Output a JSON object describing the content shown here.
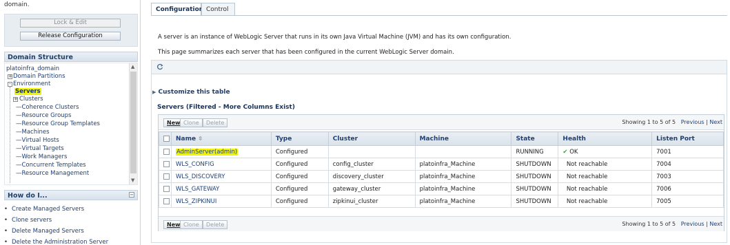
{
  "sidebar": {
    "domain_text": "domain.",
    "lock_edit": "Lock & Edit",
    "release_config": "Release Configuration",
    "domain_structure_title": "Domain Structure",
    "tree": {
      "root": "platoinfra_domain",
      "domain_partitions": "Domain Partitions",
      "environment": "Environment",
      "servers": "Servers",
      "clusters": "Clusters",
      "coherence_clusters": "Coherence Clusters",
      "resource_groups": "Resource Groups",
      "resource_group_templates": "Resource Group Templates",
      "machines": "Machines",
      "virtual_hosts": "Virtual Hosts",
      "virtual_targets": "Virtual Targets",
      "work_managers": "Work Managers",
      "concurrent_templates": "Concurrent Templates",
      "resource_management": "Resource Management"
    },
    "how_do_i_title": "How do I...",
    "how_items": [
      "Create Managed Servers",
      "Clone servers",
      "Delete Managed Servers",
      "Delete the Administration Server"
    ]
  },
  "tabs": {
    "configuration": "Configuration",
    "control": "Control"
  },
  "description": {
    "line1": "A server is an instance of WebLogic Server that runs in its own Java Virtual Machine (JVM) and has its own configuration.",
    "line2": "This page summarizes each server that has been configured in the current WebLogic Server domain."
  },
  "customize": "Customize this table",
  "table_title": "Servers (Filtered - More Columns Exist)",
  "buttons": {
    "new": "New",
    "clone": "Clone",
    "delete": "Delete"
  },
  "paging": {
    "showing": "Showing 1 to 5 of 5",
    "previous": "Previous",
    "separator": "|",
    "next": "Next"
  },
  "columns": [
    "Name",
    "Type",
    "Cluster",
    "Machine",
    "State",
    "Health",
    "Listen Port"
  ],
  "rows": [
    {
      "name": "AdminServer(admin)",
      "type": "Configured",
      "cluster": "",
      "machine": "",
      "state": "RUNNING",
      "health": "OK",
      "port": "7001"
    },
    {
      "name": "WLS_CONFIG",
      "type": "Configured",
      "cluster": "config_cluster",
      "machine": "platoinfra_Machine",
      "state": "SHUTDOWN",
      "health": "Not reachable",
      "port": "7004"
    },
    {
      "name": "WLS_DISCOVERY",
      "type": "Configured",
      "cluster": "discovery_cluster",
      "machine": "platoinfra_Machine",
      "state": "SHUTDOWN",
      "health": "Not reachable",
      "port": "7003"
    },
    {
      "name": "WLS_GATEWAY",
      "type": "Configured",
      "cluster": "gateway_cluster",
      "machine": "platoinfra_Machine",
      "state": "SHUTDOWN",
      "health": "Not reachable",
      "port": "7006"
    },
    {
      "name": "WLS_ZIPKINUI",
      "type": "Configured",
      "cluster": "zipkinui_cluster",
      "machine": "platoinfra_Machine",
      "state": "SHUTDOWN",
      "health": "Not reachable",
      "port": "7005"
    }
  ],
  "colors": {
    "link": "#1e3f75",
    "highlight": "#f4f400",
    "ok_check": "#3aa534"
  }
}
